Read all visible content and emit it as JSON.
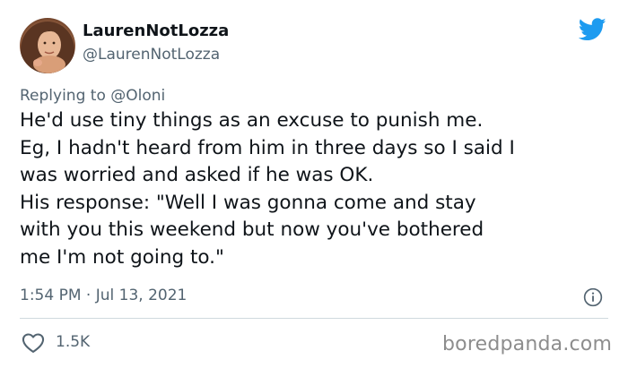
{
  "author": {
    "display_name": "LaurenNotLozza",
    "handle": "@LaurenNotLozza",
    "avatar_icon": "profile-photo"
  },
  "brand": {
    "icon": "twitter-bird-icon",
    "color": "#1d9bf0"
  },
  "reply": {
    "prefix": "Replying to",
    "mention": "@Oloni"
  },
  "tweet": {
    "lines": [
      "He'd use tiny things as an excuse to punish me.",
      "Eg, I hadn't heard from him in three days so I said I",
      "was worried and asked if he was OK.",
      "His response: \"Well I was gonna come and stay",
      "with you this weekend but now you've bothered",
      "me I'm not going to.\""
    ],
    "timestamp": "1:54 PM · Jul 13, 2021"
  },
  "engagement": {
    "likes": "1.5K",
    "like_icon": "heart-icon",
    "info_icon": "info-icon"
  },
  "watermark": "boredpanda.com",
  "colors": {
    "text": "#0f1419",
    "secondary": "#536471",
    "divider": "#cfd9de"
  }
}
